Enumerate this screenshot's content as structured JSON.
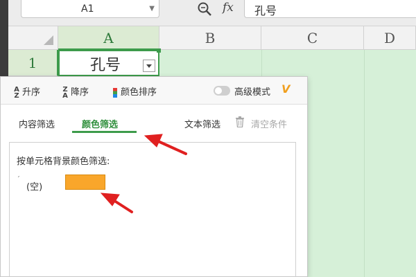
{
  "formula_bar": {
    "name_box": "A1",
    "fx": "fx",
    "content": "孔号"
  },
  "grid": {
    "columns": [
      "A",
      "B",
      "C",
      "D"
    ],
    "rows": [
      "1"
    ],
    "a1_value": "孔号"
  },
  "filter_panel": {
    "sort_asc": "升序",
    "sort_desc": "降序",
    "sort_color": "颜色排序",
    "advanced_mode": "高级模式",
    "vip_badge": "V",
    "tabs": [
      {
        "label": "内容筛选",
        "active": false
      },
      {
        "label": "颜色筛选",
        "active": true
      }
    ],
    "text_filter": "文本筛选",
    "clear_conditions": "清空条件",
    "instruction": "按单元格背景颜色筛选:",
    "empty_option": "(空)",
    "swatch_color": "#f9a62b"
  },
  "colors": {
    "accent_green": "#3d9b4b",
    "grid_fill_green": "#d6f0d8",
    "annotation_red": "#e02020"
  }
}
